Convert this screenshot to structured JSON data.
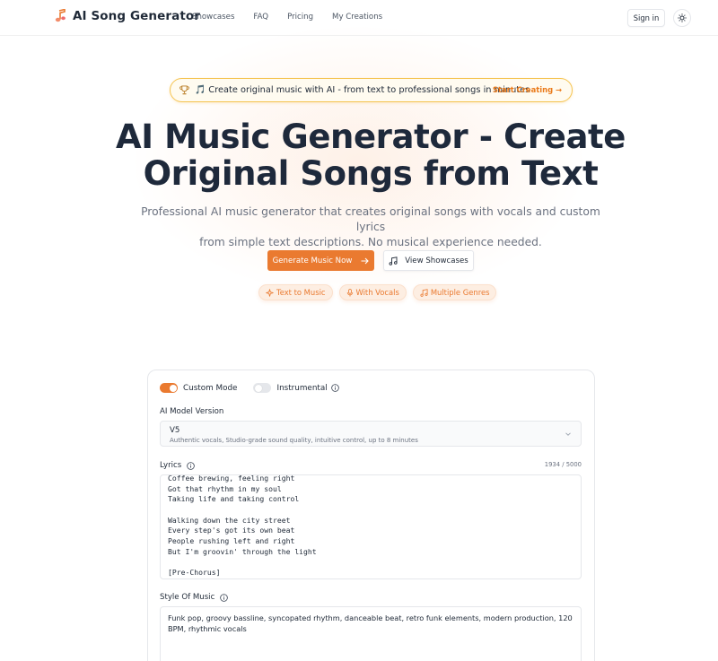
{
  "brand": {
    "name": "AI Song Generator",
    "icon": "music-note-icon",
    "accent": "#ea7a30"
  },
  "nav": {
    "links": [
      "Showcases",
      "FAQ",
      "Pricing",
      "My Creations"
    ],
    "sign_in": "Sign in",
    "theme_icon": "sun-icon"
  },
  "banner": {
    "icon": "trophy-icon",
    "text": "🎵 Create original music with AI - from text to professional songs in minutes",
    "cta": "Start Creating →"
  },
  "hero": {
    "title_line1": "AI Music Generator - Create",
    "title_line2": "Original Songs from Text",
    "subtitle_line1": "Professional AI music generator that creates original songs with vocals and custom lyrics",
    "subtitle_line2": "from simple text descriptions. No musical experience needed.",
    "primary_button": "Generate Music Now",
    "secondary_button": "View Showcases",
    "chips": [
      {
        "label": "Text to Music",
        "icon": "sparkles-icon"
      },
      {
        "label": "With Vocals",
        "icon": "microphone-icon"
      },
      {
        "label": "Multiple Genres",
        "icon": "music-icon"
      }
    ]
  },
  "form": {
    "custom_mode": {
      "label": "Custom Mode",
      "on": true
    },
    "instrumental": {
      "label": "Instrumental",
      "on": false
    },
    "model": {
      "label": "AI Model Version",
      "selected": "V5",
      "description": "Authentic vocals, Studio-grade sound quality, intuitive control, up to 8 minutes"
    },
    "lyrics": {
      "label": "Lyrics",
      "counter": "1934 / 5000",
      "lines": [
        "Coffee brewing, feeling right",
        "Got that rhythm in my soul",
        "Taking life and taking control",
        "",
        "Walking down the city street",
        "Every step's got its own beat",
        "People rushing left and right",
        "But I'm groovin' through the light",
        "",
        "[Pre-Chorus]"
      ]
    },
    "style": {
      "label": "Style Of Music",
      "value": "Funk pop, groovy bassline, syncopated rhythm, danceable beat, retro funk elements, modern production, 120 BPM, rhythmic vocals"
    }
  }
}
